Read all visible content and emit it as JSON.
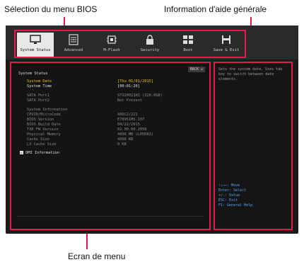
{
  "callouts": {
    "bios_menu": "Sélection du menu BIOS",
    "help_info": "Information d'aide générale",
    "menu_screen": "Ecran de menu"
  },
  "menu": {
    "items": [
      {
        "label": "System Status",
        "icon": "monitor-icon"
      },
      {
        "label": "Advanced",
        "icon": "advanced-settings-icon"
      },
      {
        "label": "M-Flash",
        "icon": "chip-icon"
      },
      {
        "label": "Security",
        "icon": "lock-icon"
      },
      {
        "label": "Boot",
        "icon": "boot-drives-icon"
      },
      {
        "label": "Save & Exit",
        "icon": "floppy-disk-icon"
      }
    ]
  },
  "main": {
    "back_label": "BACK",
    "section_title": "System Status",
    "system_date_label": "System Date",
    "system_date_value": "[Thu 01/01/2015]",
    "system_time_label": "System Time",
    "system_time_value": "[00:01:20]",
    "sata": [
      {
        "label": "SATA Port1",
        "value": "ST320013AS    (320.0GB)"
      },
      {
        "label": "SATA Port2",
        "value": "Not Present"
      }
    ],
    "sysinfo_title": "System Information",
    "sysinfo": [
      {
        "label": "CPUID/MicroCode",
        "value": "406C2/221"
      },
      {
        "label": "BIOS Version",
        "value": "E7895IMS.107"
      },
      {
        "label": "BIOS Build Date",
        "value": "04/22/2015"
      },
      {
        "label": "TXE FW Version",
        "value": "02.00.00.2058"
      },
      {
        "label": "Physical Memory",
        "value": "4096 MB (LPDDR3)"
      },
      {
        "label": "Cache Size",
        "value": "4096 KB"
      },
      {
        "label": "L3 Cache Size",
        "value": "0 KB"
      }
    ],
    "dmi_label": "DMI Information"
  },
  "help": {
    "text": "Sets the system date.  Uses tab key to switch between date elements.",
    "keys": [
      "↑↓→←: Move",
      "Enter: Select",
      "+/-: Value",
      "ESC: Exit",
      "F1: General Help"
    ]
  },
  "colors": {
    "accent": "#e61a4a",
    "highlight_text": "#f2c400",
    "help_keys": "#5aa0ff"
  }
}
